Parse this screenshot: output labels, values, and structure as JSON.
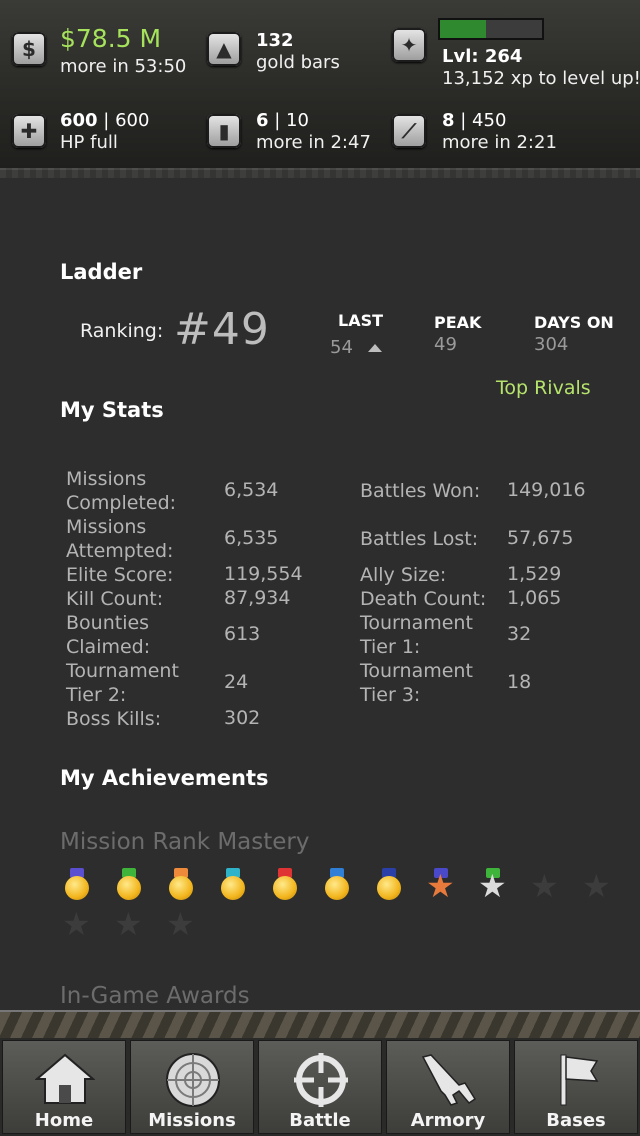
{
  "hud": {
    "cash": {
      "value": "$78.5 M",
      "sub": "more in 53:50",
      "icon": "cash-icon"
    },
    "gold": {
      "value": "132",
      "sub": "gold bars",
      "icon": "gold-bars-icon"
    },
    "level": {
      "value": "Lvl: 264",
      "sub": "13,152 xp to level up!",
      "xp_progress": 0.45,
      "icon": "rank-emblem-icon"
    },
    "hp": {
      "current": "600",
      "max": "600",
      "sub": "HP full",
      "icon": "health-cross-icon"
    },
    "energy": {
      "current": "6",
      "max": "10",
      "sub": "more in 2:47",
      "icon": "energy-canister-icon"
    },
    "ammo": {
      "current": "8",
      "max": "450",
      "sub": "more in 2:21",
      "icon": "ammo-knife-icon"
    },
    "separator": " | "
  },
  "ladder": {
    "title": "Ladder",
    "ranking_label": "Ranking:",
    "ranking_value": "#49",
    "last_label": "LAST",
    "last_value": "54",
    "peak_label": "PEAK",
    "peak_value": "49",
    "days_label": "DAYS ON",
    "days_value": "304",
    "top_rivals": "Top Rivals"
  },
  "stats": {
    "title": "My Stats",
    "left": [
      {
        "label": "Missions Completed:",
        "value": "6,534"
      },
      {
        "label": "Missions Attempted:",
        "value": "6,535"
      },
      {
        "label": "Elite Score:",
        "value": "119,554"
      },
      {
        "label": "Kill Count:",
        "value": "87,934"
      },
      {
        "label": "Bounties Claimed:",
        "value": "613"
      },
      {
        "label": "Tournament Tier 2:",
        "value": "24"
      },
      {
        "label": "Boss Kills:",
        "value": "302"
      }
    ],
    "right": [
      {
        "label": "Battles Won:",
        "value": "149,016"
      },
      {
        "label": "Battles Lost:",
        "value": "57,675"
      },
      {
        "label": "Ally Size:",
        "value": "1,529"
      },
      {
        "label": "Death Count:",
        "value": "1,065"
      },
      {
        "label": "Tournament Tier 1:",
        "value": "32"
      },
      {
        "label": "Tournament Tier 3:",
        "value": "18"
      }
    ]
  },
  "achievements": {
    "title": "My Achievements",
    "mission_rank_title": "Mission Rank Mastery",
    "medals": [
      {
        "type": "medal",
        "ribbon": "#5b4fd1"
      },
      {
        "type": "medal",
        "ribbon": "#3fb43a"
      },
      {
        "type": "medal",
        "ribbon": "#f08a3b"
      },
      {
        "type": "medal",
        "ribbon": "#2fb3c9"
      },
      {
        "type": "medal",
        "ribbon": "#e03333"
      },
      {
        "type": "medal",
        "ribbon": "#2f7fd6"
      },
      {
        "type": "medal",
        "ribbon": "#2a3fa8"
      },
      {
        "type": "star",
        "color": "#e87a3c",
        "ribbon": "#4a49c9"
      },
      {
        "type": "star",
        "color": "#dcdcdc",
        "ribbon": "#3fb43a"
      },
      {
        "type": "locked"
      },
      {
        "type": "locked"
      },
      {
        "type": "locked"
      },
      {
        "type": "locked"
      },
      {
        "type": "locked"
      }
    ],
    "in_game_awards_title": "In-Game Awards"
  },
  "tabs": [
    {
      "label": "Home",
      "icon": "home-icon"
    },
    {
      "label": "Missions",
      "icon": "radar-icon"
    },
    {
      "label": "Battle",
      "icon": "crosshair-icon"
    },
    {
      "label": "Armory",
      "icon": "rifle-icon"
    },
    {
      "label": "Bases",
      "icon": "flag-icon"
    }
  ]
}
